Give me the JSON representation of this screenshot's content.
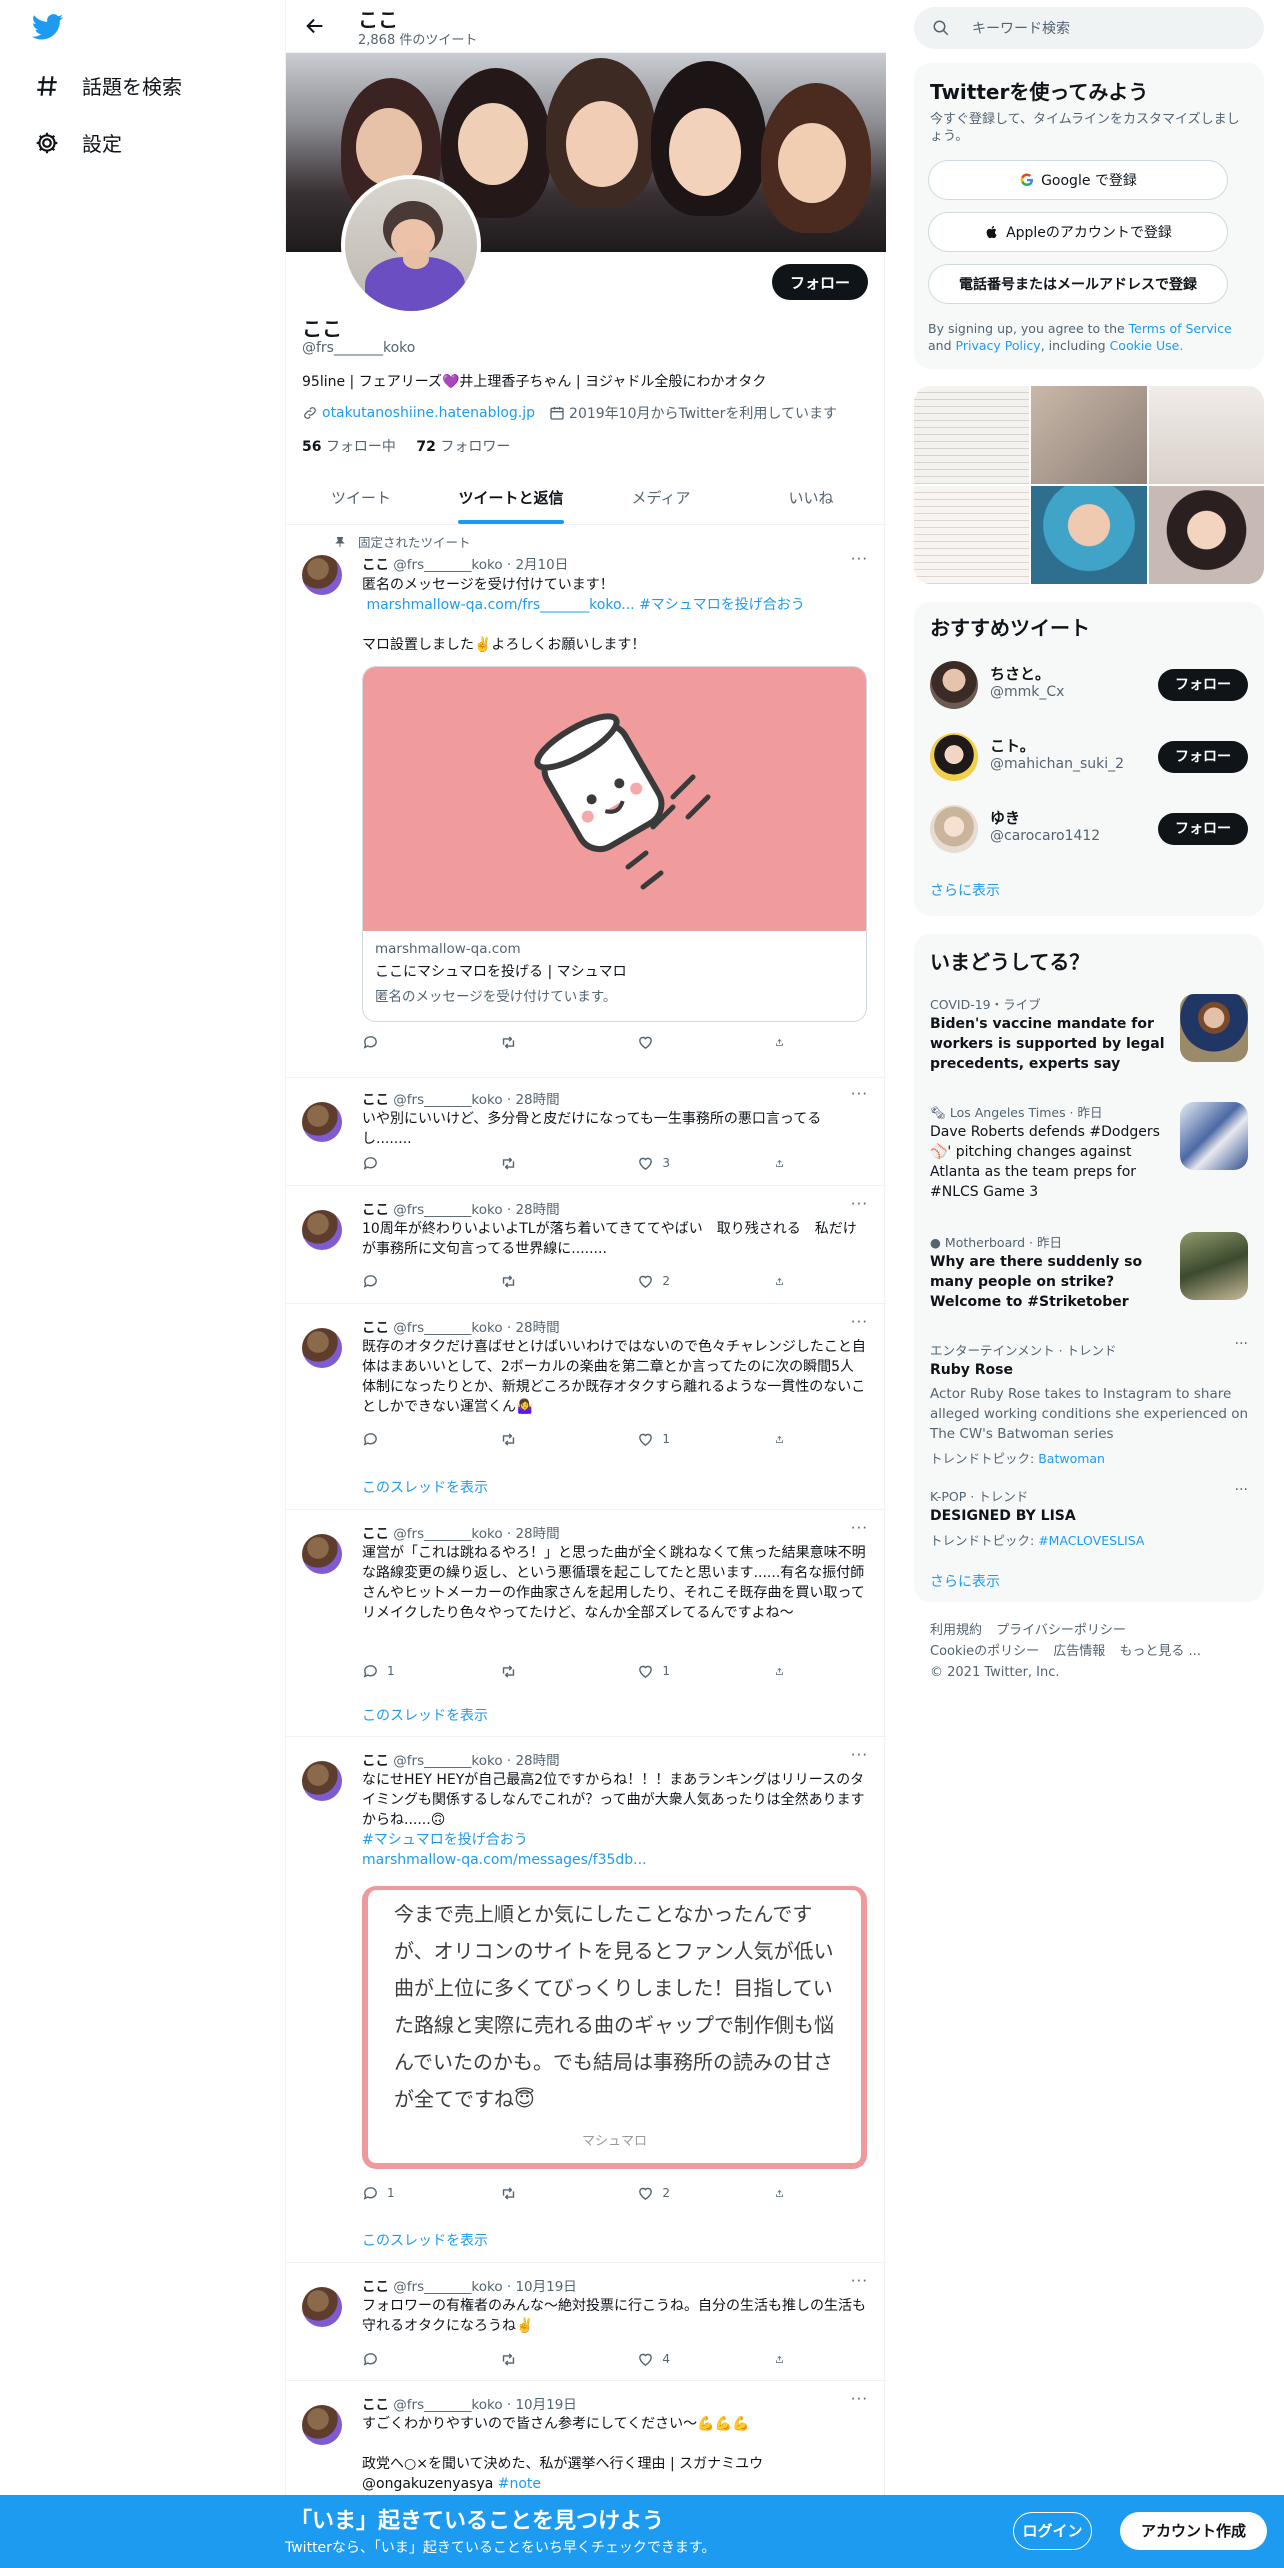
{
  "nav": {
    "explore": "話題を検索",
    "settings": "設定"
  },
  "profile": {
    "header_name": "ここ",
    "tweet_count": "2,868 件のツイート",
    "name": "ここ",
    "handle": "@frs_______koko",
    "bio": "95line | フェアリーズ💜井上理香子ちゃん | ヨジャドル全般にわかオタク",
    "link": "otakutanoshiine.hatenablog.jp",
    "joined": "2019年10月からTwitterを利用しています",
    "following_count": "56",
    "following_label": "フォロー中",
    "followers_count": "72",
    "followers_label": "フォロワー",
    "follow_button": "フォロー"
  },
  "tabs": [
    "ツイート",
    "ツイートと返信",
    "メディア",
    "いいね"
  ],
  "pinned_label": "固定されたツイート",
  "tweets": [
    {
      "name": "ここ",
      "handle": "@frs_______koko",
      "time": "2月10日",
      "text1": "匿名のメッセージを受け付けています！",
      "link": "marshmallow-qa.com/frs_______koko...",
      "hashtag": "#マシュマロを投げ合おう",
      "text2": "マロ設置しました✌️よろしくお願いします！",
      "card_domain": "marshmallow-qa.com",
      "card_title": "ここにマシュマロを投げる | マシュマロ",
      "card_desc": "匿名のメッセージを受け付けています。",
      "replies": "",
      "retweets": "",
      "likes": ""
    },
    {
      "name": "ここ",
      "handle": "@frs_______koko",
      "time": "28時間",
      "text": "いや別にいいけど、多分骨と皮だけになっても一生事務所の悪口言ってるし........",
      "replies": "",
      "retweets": "",
      "likes": "3"
    },
    {
      "name": "ここ",
      "handle": "@frs_______koko",
      "time": "28時間",
      "text": "10周年が終わりいよいよTLが落ち着いてきててやばい　取り残される　私だけが事務所に文句言ってる世界線に........",
      "replies": "",
      "retweets": "",
      "likes": "2"
    },
    {
      "name": "ここ",
      "handle": "@frs_______koko",
      "time": "28時間",
      "text": "既存のオタクだけ喜ばせとけばいいわけではないので色々チャレンジしたこと自体はまあいいとして、2ボーカルの楽曲を第二章とか言ってたのに次の瞬間5人体制になったりとか、新規どころか既存オタクすら離れるような一貫性のないことしかできない運営くん🤷‍♀️",
      "replies": "",
      "retweets": "",
      "likes": "1",
      "thread": "このスレッドを表示"
    },
    {
      "name": "ここ",
      "handle": "@frs_______koko",
      "time": "28時間",
      "text": "運営が「これは跳ねるやろ！」と思った曲が全く跳ねなくて焦った結果意味不明な路線変更の繰り返し、という悪循環を起こしてたと思います......有名な振付師さんやヒットメーカーの作曲家さんを起用したり、それこそ既存曲を買い取ってリメイクしたり色々やってたけど、なんか全部ズレてるんですよね〜",
      "replies": "1",
      "retweets": "",
      "likes": "1",
      "thread": "このスレッドを表示"
    },
    {
      "name": "ここ",
      "handle": "@frs_______koko",
      "time": "28時間",
      "text": "なにせHEY HEYが自己最高2位ですからね！！！まあランキングはリリースのタイミングも関係するしなんでこれが？って曲が大衆人気あったりは全然ありますからね......🙃",
      "hashtag": "#マシュマロを投げ合おう",
      "link": "marshmallow-qa.com/messages/f35db...",
      "marshmallow_text": "今まで売上順とか気にしたことなかったんですが、オリコンのサイトを見るとファン人気が低い曲が上位に多くてびっくりしました！目指していた路線と実際に売れる曲のギャップで制作側も悩んでいたのかも。でも結局は事務所の読みの甘さが全てですね😇",
      "marshmallow_footer": "マシュマロ",
      "replies": "1",
      "retweets": "",
      "likes": "2",
      "thread": "このスレッドを表示"
    },
    {
      "name": "ここ",
      "handle": "@frs_______koko",
      "time": "10月19日",
      "text": "フォロワーの有権者のみんな〜絶対投票に行こうね。自分の生活も推しの生活も守れるオタクになろうね✌️",
      "replies": "",
      "retweets": "",
      "likes": "4"
    },
    {
      "name": "ここ",
      "handle": "@frs_______koko",
      "time": "10月19日",
      "text": "すごくわかりやすいので皆さん参考にしてください〜💪💪💪",
      "text2": "政党へ○×を聞いて決めた、私が選挙へ行く理由 | スガナミユウ",
      "text3": "@ongakuzenyasya",
      "hashtag": "#note"
    }
  ],
  "search": {
    "placeholder": "キーワード検索"
  },
  "signup": {
    "title": "Twitterを使ってみよう",
    "subtitle": "今すぐ登録して、タイムラインをカスタマイズしましょう。",
    "google": "Google で登録",
    "apple": "Appleのアカウントで登録",
    "phone": "電話番号またはメールアドレスで登録",
    "terms_pre": "By signing up, you agree to the",
    "terms_link": "Terms of Service",
    "terms_and": "and",
    "privacy_link": "Privacy Policy",
    "terms_incl": ", including",
    "cookie_link": "Cookie Use."
  },
  "recommend": {
    "title": "おすすめツイート",
    "users": [
      {
        "name": "ちさと。",
        "handle": "@mmk_Cx",
        "button": "フォロー"
      },
      {
        "name": "こト。",
        "handle": "@mahichan_suki_2",
        "button": "フォロー"
      },
      {
        "name": "ゆき",
        "handle": "@carocaro1412",
        "button": "フォロー"
      }
    ],
    "more": "さらに表示"
  },
  "trends": {
    "title": "いまどうしてる？",
    "items": [
      {
        "meta": "COVID-19・ライブ",
        "title": "Biden's vaccine mandate for workers is supported by legal precedents, experts say"
      },
      {
        "meta": "Los Angeles Times · 昨日",
        "title": "Dave Roberts defends #Dodgers ⚾' pitching changes against Atlanta as the team preps for #NLCS Game 3"
      },
      {
        "meta": "Motherboard · 昨日",
        "title": "Why are there suddenly so many people on strike? Welcome to #Striketober"
      },
      {
        "meta": "エンターテインメント · トレンド",
        "title": "Ruby Rose",
        "desc": "Actor Ruby Rose takes to Instagram to share alleged working conditions she experienced on The CW's Batwoman series",
        "topic_label": "トレンドトピック:",
        "topic": "Batwoman"
      },
      {
        "meta": "K-POP · トレンド",
        "title": "DESIGNED BY LISA",
        "topic_label": "トレンドトピック:",
        "topic": "#MACLOVESLISA"
      }
    ],
    "more": "さらに表示"
  },
  "footer": {
    "terms": "利用規約",
    "privacy": "プライバシーポリシー",
    "cookie": "Cookieのポリシー",
    "ads": "広告情報",
    "more": "もっと見る ...",
    "copyright": "© 2021 Twitter, Inc."
  },
  "bottom_bar": {
    "title": "「いま」起きていることを見つけよう",
    "subtitle": "Twitterなら、「いま」起きていることをいち早くチェックできます。",
    "login": "ログイン",
    "signup": "アカウント作成"
  },
  "colors": {
    "accent": "#1d9bf0",
    "text": "#0f1419",
    "muted": "#536471",
    "marshmallow_pink": "#f19c9c"
  }
}
